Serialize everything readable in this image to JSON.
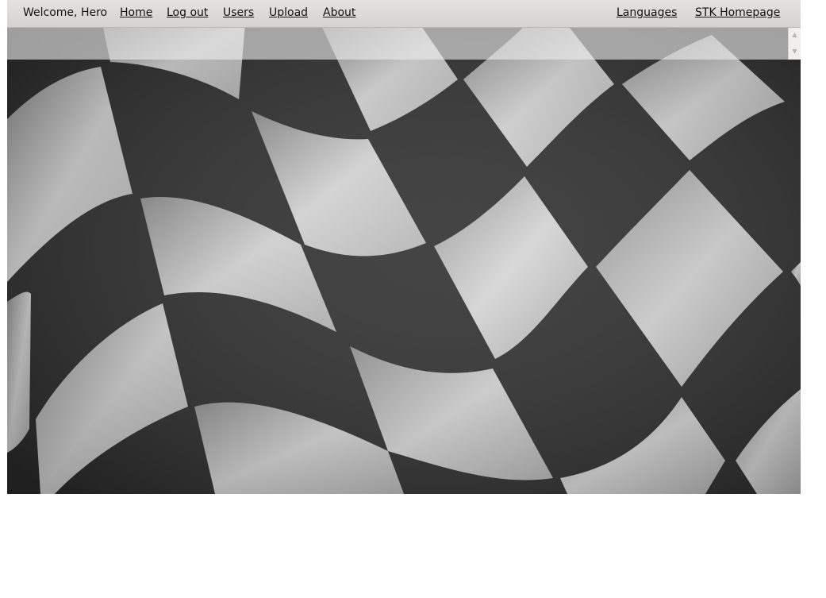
{
  "topbar": {
    "welcome": "Welcome, Hero",
    "nav": {
      "home": "Home",
      "logout": "Log out",
      "users": "Users",
      "upload": "Upload",
      "about": "About"
    },
    "right": {
      "languages": "Languages",
      "stk_homepage": "STK Homepage"
    }
  },
  "scroller": {
    "up_icon": "triangle-up",
    "down_icon": "triangle-down"
  },
  "colors": {
    "topbar": "#e0dcda",
    "flag_dark": "#2a2a2a",
    "flag_light": "#c8c8c8"
  }
}
